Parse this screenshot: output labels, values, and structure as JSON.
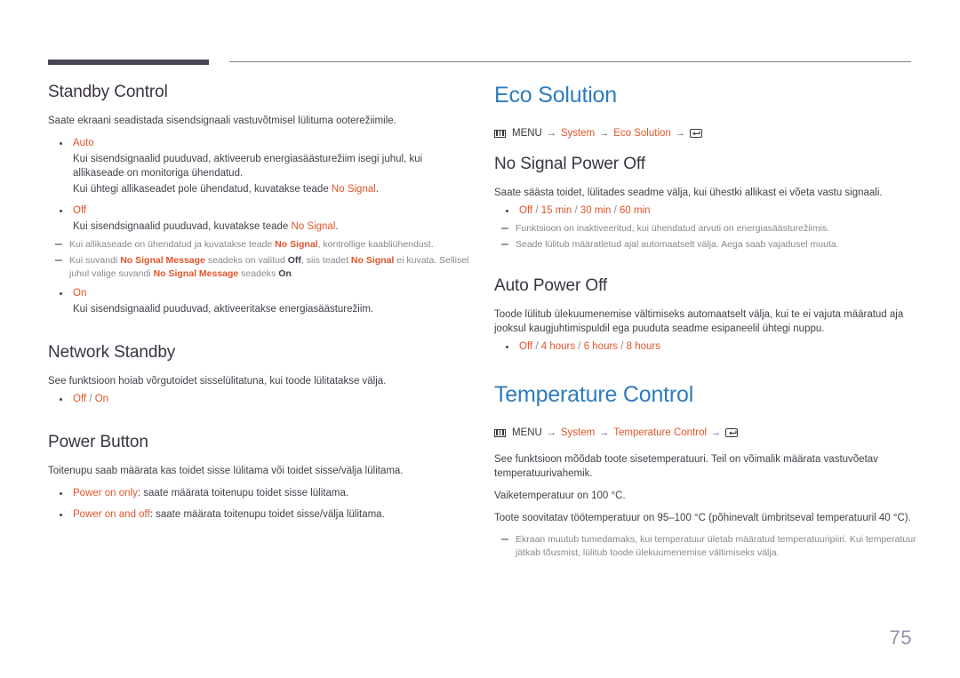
{
  "page": {
    "number": "75"
  },
  "left_column": {
    "standby_control": {
      "heading": "Standby Control",
      "intro": "Saate ekraani seadistada sisendsignaali vastuvõtmisel lülituma ooterežiimile.",
      "options": [
        {
          "label": "Auto",
          "lines": [
            "Kui sisendsignaalid puuduvad, aktiveerub energiasäästurežiim isegi juhul, kui allikaseade on monitoriga ühendatud.",
            "Kui ühtegi allikaseadet pole ühendatud, kuvatakse teade No Signal."
          ]
        },
        {
          "label": "Off",
          "lines": [
            "Kui sisendsignaalid puuduvad, kuvatakse teade No Signal."
          ]
        },
        {
          "label": "On",
          "lines": [
            "Kui sisendsignaalid puuduvad, aktiveeritakse energiasäästurežiim."
          ]
        }
      ],
      "notes": [
        "Kui allikaseade on ühendatud ja kuvatakse teade No Signal, kontrollige kaabliühendust.",
        "Kui suvandi No Signal Message seadeks on valitud Off, siis teadet No Signal ei kuvata. Sellisel juhul valige suvandi No Signal Message seadeks On."
      ],
      "inline_terms": {
        "no_signal": "No Signal",
        "no_signal_message": "No Signal Message",
        "off": "Off",
        "on": "On"
      },
      "fragments": {
        "auto_line2_a": "Kui ühtegi allikaseadet pole ühendatud, kuvatakse teade ",
        "auto_line2_b": ".",
        "off_line1_a": "Kui sisendsignaalid puuduvad, kuvatakse teade ",
        "off_line1_b": ".",
        "note1_a": "Kui allikaseade on ühendatud ja kuvatakse teade ",
        "note1_b": ", kontrollige kaabliühendust.",
        "note2_a": "Kui suvandi ",
        "note2_b": " seadeks on valitud ",
        "note2_c": ", siis teadet ",
        "note2_d": " ei kuvata. Sellisel juhul valige suvandi ",
        "note2_e": " seadeks ",
        "note2_f": "."
      }
    },
    "network_standby": {
      "heading": "Network Standby",
      "intro": "See funktsioon hoiab võrgutoidet sisselülitatuna, kui toode lülitatakse välja.",
      "values": [
        "Off",
        "On"
      ],
      "value_line": "Off / On"
    },
    "power_button": {
      "heading": "Power Button",
      "intro": "Toitenupu saab määrata kas toidet sisse lülitama või toidet sisse/välja lülitama.",
      "options": [
        {
          "label": "Power on only",
          "desc": ": saate määrata toitenupu toidet sisse lülitama."
        },
        {
          "label": "Power on and off",
          "desc": ": saate määrata toitenupu toidet sisse/välja lülitama."
        }
      ]
    }
  },
  "right_column": {
    "eco_solution": {
      "heading": "Eco Solution",
      "menu_path": {
        "menu_icon": "menu-icon",
        "menu_label": "MENU",
        "arrow": "→",
        "item1": "System",
        "item2": "Eco Solution",
        "enter_icon": "enter-key-icon"
      },
      "no_signal_power_off": {
        "heading": "No Signal Power Off",
        "intro": "Saate säästa toidet, lülitades seadme välja, kui ühestki allikast ei võeta vastu signaali.",
        "value_line": "Off / 15 min / 30 min / 60 min",
        "values": [
          "Off",
          "15 min",
          "30 min",
          "60 min"
        ],
        "notes": [
          "Funktsioon on inaktiveeritud, kui ühendatud arvuti on energiasäästurežiimis.",
          "Seade lülitub määratletud ajal automaatselt välja. Aega saab vajadusel muuta."
        ]
      },
      "auto_power_off": {
        "heading": "Auto Power Off",
        "intro": "Toode lülitub ülekuumenemise vältimiseks automaatselt välja, kui te ei vajuta määratud aja jooksul kaugjuhtimispuldil ega puuduta seadme esipaneelil ühtegi nuppu.",
        "value_line": "Off / 4 hours / 6 hours / 8 hours",
        "values": [
          "Off",
          "4 hours",
          "6 hours",
          "8 hours"
        ]
      }
    },
    "temperature_control": {
      "heading": "Temperature Control",
      "menu_path": {
        "menu_icon": "menu-icon",
        "menu_label": "MENU",
        "arrow": "→",
        "item1": "System",
        "item2": "Temperature Control",
        "enter_icon": "enter-key-icon"
      },
      "intro": "See funktsioon mõõdab toote sisetemperatuuri. Teil on võimalik määrata vastuvõetav temperatuurivahemik.",
      "default_temp": "Vaiketemperatuur on 100 °C.",
      "recommended_temp": "Toote soovitatav töötemperatuur on 95–100 °C (põhinevalt ümbritseval temperatuuril 40 °C).",
      "note": "Ekraan muutub tumedamaks, kui temperatuur ületab määratud temperatuuripiiri. Kui temperatuur jätkab tõusmist, lülitub toode ülekuumenemise vältimiseks välja."
    }
  },
  "colors": {
    "accent_orange": "#e2542a",
    "heading_blue": "#2e7cbf",
    "heading_dark": "#3b3342",
    "note_gray": "#8a868e",
    "rule_dark": "#484455",
    "page_number": "#8f94ad"
  }
}
